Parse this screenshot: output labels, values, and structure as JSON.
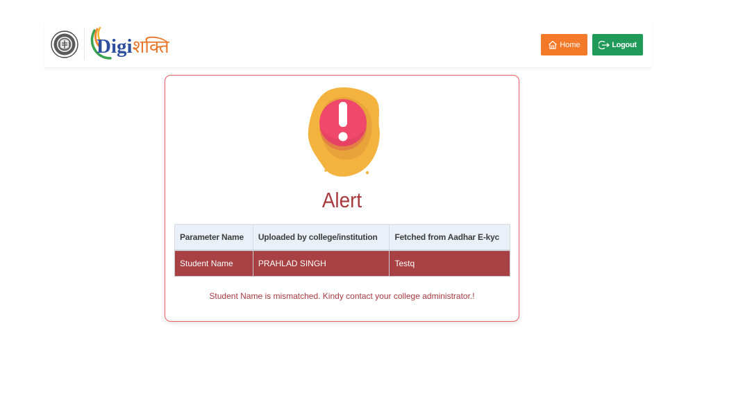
{
  "header": {
    "logo": {
      "latin": "Digi",
      "hindi": "शक्ति"
    },
    "emblem_icon": "uttar-pradesh-emblem-icon",
    "home_button": {
      "label": "Home",
      "icon": "home-icon",
      "color": "#f47a2a"
    },
    "logout_button": {
      "label": "Logout",
      "icon": "logout-icon",
      "color": "#1f9a58"
    }
  },
  "alert": {
    "icon": "exclamation-alert-icon",
    "title": "Alert",
    "accent_color": "#a8393e",
    "table": {
      "columns": [
        "Parameter Name",
        "Uploaded by college/institution",
        "Fetched from Aadhar E-kyc"
      ],
      "rows": [
        [
          "Student Name",
          "PRAHLAD SINGH",
          "Testq"
        ]
      ]
    },
    "message": "Student Name is mismatched. Kindy contact your college administrator.!"
  }
}
